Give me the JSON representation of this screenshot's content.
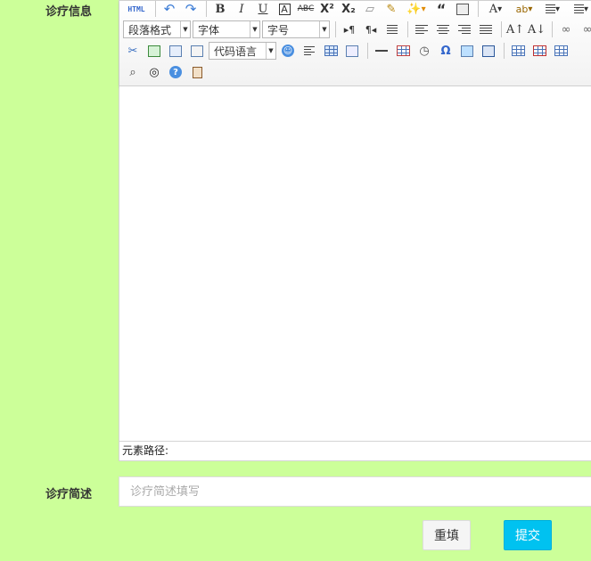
{
  "form": {
    "info_label": "诊疗信息",
    "brief_label": "诊疗简述",
    "brief_placeholder": "诊疗简述填写",
    "reset_label": "重填",
    "submit_label": "提交"
  },
  "editor": {
    "paragraph_select": "段落格式",
    "font_select": "字体",
    "size_select": "字号",
    "code_select": "代码语言",
    "element_path_label": "元素路径:",
    "html_button": "HTML"
  },
  "colors": {
    "page_background": "#ccff99",
    "submit_background": "#00c2f0",
    "reset_background": "#f5f5f5"
  },
  "icons": {
    "row1": [
      "source-code-icon",
      "undo-icon",
      "redo-icon",
      "bold-icon",
      "italic-icon",
      "underline-icon",
      "font-border-icon",
      "strikethrough-icon",
      "superscript-icon",
      "subscript-icon",
      "eraser-icon",
      "format-brush-icon",
      "auto-format-icon",
      "blockquote-icon",
      "paste-plain-icon",
      "font-color-icon",
      "highlight-icon",
      "ordered-list-icon",
      "unordered-list-icon"
    ],
    "row2": [
      "ltr-icon",
      "rtl-icon",
      "indent-icon",
      "align-left-icon",
      "align-center-icon",
      "align-right-icon",
      "align-justify-icon",
      "uppercase-icon",
      "lowercase-icon",
      "link-icon",
      "unlink-icon"
    ],
    "row3": [
      "attachment-icon",
      "image-icon",
      "insert-image-icon",
      "multi-image-icon",
      "emotion-icon",
      "page-break-icon",
      "template-icon",
      "background-icon",
      "horizontal-rule-icon",
      "date-icon",
      "time-icon",
      "special-char-icon",
      "map-icon",
      "word-image-icon",
      "insert-table-icon",
      "delete-table-icon",
      "table-title-icon"
    ],
    "row4": [
      "search-replace-icon",
      "preview-icon",
      "help-icon",
      "draft-icon"
    ]
  }
}
